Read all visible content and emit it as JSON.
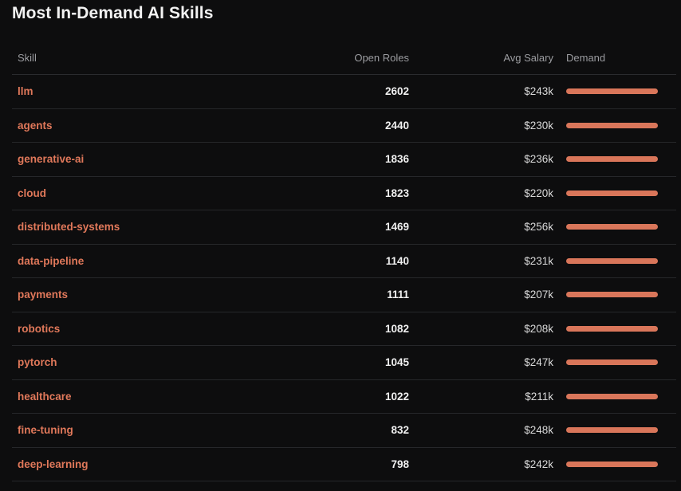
{
  "page": {
    "title": "Most In-Demand AI Skills"
  },
  "table": {
    "columns": {
      "skill": "Skill",
      "open_roles": "Open Roles",
      "avg_salary": "Avg Salary",
      "demand": "Demand"
    },
    "accent_color": "#d9765a",
    "rows": [
      {
        "skill": "llm",
        "open_roles": "2602",
        "avg_salary": "$243k",
        "demand": 1.0
      },
      {
        "skill": "agents",
        "open_roles": "2440",
        "avg_salary": "$230k",
        "demand": 1.0
      },
      {
        "skill": "generative-ai",
        "open_roles": "1836",
        "avg_salary": "$236k",
        "demand": 1.0
      },
      {
        "skill": "cloud",
        "open_roles": "1823",
        "avg_salary": "$220k",
        "demand": 1.0
      },
      {
        "skill": "distributed-systems",
        "open_roles": "1469",
        "avg_salary": "$256k",
        "demand": 1.0
      },
      {
        "skill": "data-pipeline",
        "open_roles": "1140",
        "avg_salary": "$231k",
        "demand": 1.0
      },
      {
        "skill": "payments",
        "open_roles": "1111",
        "avg_salary": "$207k",
        "demand": 1.0
      },
      {
        "skill": "robotics",
        "open_roles": "1082",
        "avg_salary": "$208k",
        "demand": 1.0
      },
      {
        "skill": "pytorch",
        "open_roles": "1045",
        "avg_salary": "$247k",
        "demand": 1.0
      },
      {
        "skill": "healthcare",
        "open_roles": "1022",
        "avg_salary": "$211k",
        "demand": 1.0
      },
      {
        "skill": "fine-tuning",
        "open_roles": "832",
        "avg_salary": "$248k",
        "demand": 1.0
      },
      {
        "skill": "deep-learning",
        "open_roles": "798",
        "avg_salary": "$242k",
        "demand": 1.0
      }
    ]
  }
}
